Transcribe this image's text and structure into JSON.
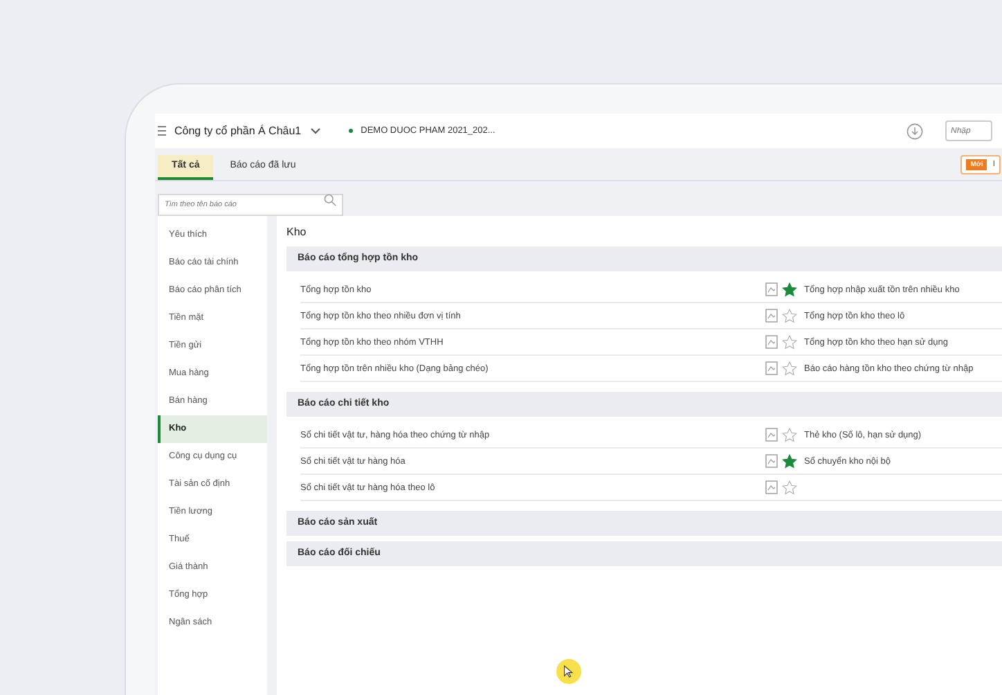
{
  "app_bar": {
    "company": "Công ty cổ phần Á Châu1",
    "database": "DEMO DUOC PHAM 2021_202...",
    "input_placeholder": "Nhập"
  },
  "tabs": [
    {
      "label": "Tất cả",
      "selected": true
    },
    {
      "label": "Báo cáo đã lưu",
      "selected": false
    }
  ],
  "new_badge": {
    "label": "Mới",
    "text": "I"
  },
  "search": {
    "placeholder": "Tìm theo tên báo cáo"
  },
  "sidebar": {
    "items": [
      {
        "label": "Yêu thích",
        "selected": false
      },
      {
        "label": "Báo cáo tài chính",
        "selected": false
      },
      {
        "label": "Báo cáo phân tích",
        "selected": false
      },
      {
        "label": "Tiền mặt",
        "selected": false
      },
      {
        "label": "Tiền gửi",
        "selected": false
      },
      {
        "label": "Mua hàng",
        "selected": false
      },
      {
        "label": "Bán hàng",
        "selected": false
      },
      {
        "label": "Kho",
        "selected": true
      },
      {
        "label": "Công cụ dụng cụ",
        "selected": false
      },
      {
        "label": "Tài sản cố định",
        "selected": false
      },
      {
        "label": "Tiền lương",
        "selected": false
      },
      {
        "label": "Thuế",
        "selected": false
      },
      {
        "label": "Giá thành",
        "selected": false
      },
      {
        "label": "Tổng hợp",
        "selected": false
      },
      {
        "label": "Ngân sách",
        "selected": false
      }
    ]
  },
  "main": {
    "title": "Kho",
    "groups": [
      {
        "title": "Báo cáo tổng hợp tồn kho",
        "rows": [
          {
            "name": "Tổng hợp tồn kho",
            "favorite": true,
            "right": "Tổng hợp nhập xuất tồn trên nhiều kho"
          },
          {
            "name": "Tổng hợp tồn kho theo nhiều đơn vị tính",
            "favorite": false,
            "right": "Tổng hợp tồn kho theo lô"
          },
          {
            "name": "Tổng hợp tồn kho theo nhóm VTHH",
            "favorite": false,
            "right": "Tổng hợp tồn kho theo hạn sử dụng"
          },
          {
            "name": "Tổng hợp tồn trên nhiều kho (Dạng bảng chéo)",
            "favorite": false,
            "right": "Báo cáo hàng tồn kho theo chứng từ nhập"
          }
        ]
      },
      {
        "title": "Báo cáo chi tiết kho",
        "rows": [
          {
            "name": "Sổ chi tiết vật tư, hàng hóa theo chứng từ nhập",
            "favorite": false,
            "right": "Thẻ kho (Số lô, hạn sử dụng)"
          },
          {
            "name": "Sổ chi tiết vật tư hàng hóa",
            "favorite": true,
            "right": "Sổ chuyển kho nội bộ"
          },
          {
            "name": "Sổ chi tiết vật tư hàng hóa theo lô",
            "favorite": false
          }
        ]
      },
      {
        "title": "Báo cáo sản xuất"
      },
      {
        "title": "Báo cáo đối chiếu"
      }
    ]
  }
}
